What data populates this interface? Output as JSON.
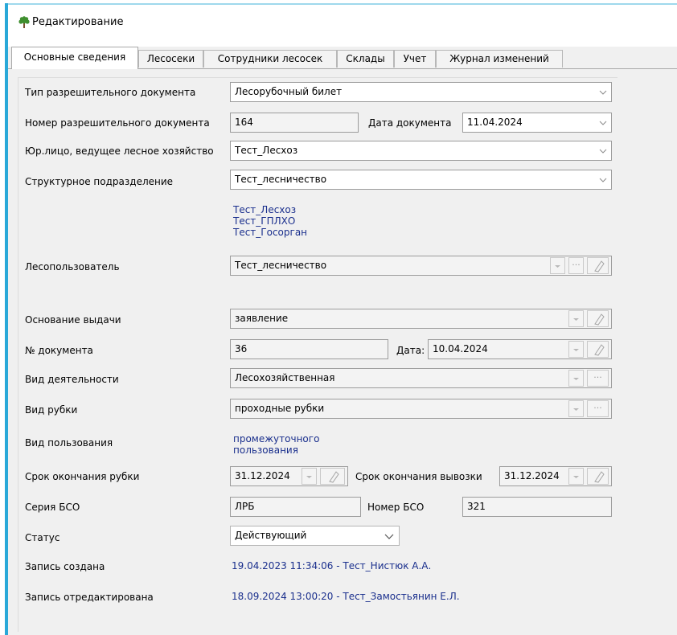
{
  "window": {
    "title": "Редактирование"
  },
  "tabs": [
    {
      "label": "Основные сведения",
      "active": true
    },
    {
      "label": "Лесосеки"
    },
    {
      "label": "Сотрудники лесосек"
    },
    {
      "label": "Склады"
    },
    {
      "label": "Учет"
    },
    {
      "label": "Журнал изменений"
    }
  ],
  "form": {
    "doc_type": {
      "label": "Тип разрешительного документа",
      "value": "Лесорубочный билет"
    },
    "doc_number": {
      "label": "Номер разрешительного документа",
      "value": "164"
    },
    "doc_date": {
      "label": "Дата документа",
      "value": "11.04.2024"
    },
    "legal_entity": {
      "label": "Юр.лицо, ведущее лесное хозяйство",
      "value": "Тест_Лесхоз"
    },
    "subdivision": {
      "label": "Структурное подразделение",
      "value": "Тест_лесничество"
    },
    "org_links": [
      "Тест_Лесхоз",
      "Тест_ГПЛХО",
      "Тест_Госорган"
    ],
    "forest_user": {
      "label": "Лесопользователь",
      "value": "Тест_лесничество"
    },
    "basis": {
      "label": "Основание выдачи",
      "value": "заявление"
    },
    "basis_doc_number": {
      "label": "№ документа",
      "value": "36"
    },
    "basis_doc_date": {
      "label": "Дата:",
      "value": "10.04.2024"
    },
    "activity": {
      "label": "Вид деятельности",
      "value": "Лесохозяйственная"
    },
    "felling_type": {
      "label": "Вид рубки",
      "value": "проходные рубки"
    },
    "usage_type": {
      "label": "Вид пользования",
      "value_line1": "промежуточного",
      "value_line2": "пользования"
    },
    "felling_end": {
      "label": "Срок окончания рубки",
      "value": "31.12.2024"
    },
    "removal_end": {
      "label": "Срок окончания вывозки",
      "value": "31.12.2024"
    },
    "bso_series": {
      "label": "Серия БСО",
      "value": "ЛРБ"
    },
    "bso_number": {
      "label": "Номер БСО",
      "value": "321"
    },
    "status": {
      "label": "Статус",
      "value": "Действующий"
    },
    "created": {
      "label": "Запись создана",
      "value": "19.04.2023 11:34:06 - Тест_Нистюк А.А."
    },
    "edited": {
      "label": "Запись отредактирована",
      "value": "18.09.2024 13:00:20 - Тест_Замостьянин Е.Л."
    }
  },
  "icons": {
    "ellipsis": "···"
  },
  "colors": {
    "accent": "#29a8d8",
    "link": "#1a2f8d"
  }
}
